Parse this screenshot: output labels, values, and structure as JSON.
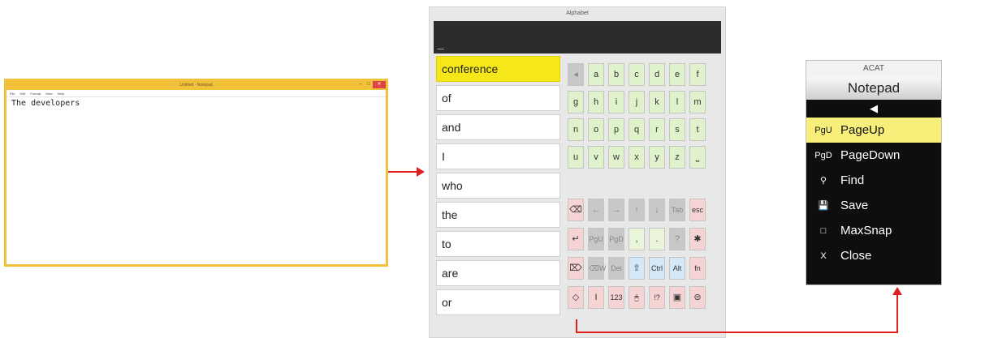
{
  "notepad": {
    "title": "Untitled - Notepad",
    "controls": [
      "–",
      "□",
      "✕"
    ],
    "menu": [
      "File",
      "Edit",
      "Format",
      "View",
      "Help"
    ],
    "text": "The developers"
  },
  "alphabet": {
    "title": "Alphabet",
    "input_cursor": "_",
    "words": [
      "conference",
      "of",
      "and",
      "I",
      "who",
      "the",
      "to",
      "are",
      "or"
    ],
    "letters": [
      [
        "◂",
        "a",
        "b",
        "c",
        "d",
        "e",
        "f"
      ],
      [
        "g",
        "h",
        "i",
        "j",
        "k",
        "l",
        "m"
      ],
      [
        "n",
        "o",
        "p",
        "q",
        "r",
        "s",
        "t"
      ],
      [
        "u",
        "v",
        "w",
        "x",
        "y",
        "z",
        "⎵"
      ]
    ],
    "controls": [
      [
        "⌫",
        "←",
        "→",
        "↑",
        "↓",
        "Tab",
        "esc"
      ],
      [
        "↵",
        "PgU",
        "PgD",
        ",",
        ".",
        "?",
        "✱"
      ],
      [
        "⌦",
        "⌫W",
        "Del",
        "⇧",
        "Ctrl",
        "Alt",
        "fn"
      ],
      [
        "◇",
        "I",
        "123",
        "🖱",
        "!?",
        "▣",
        "⊜"
      ]
    ]
  },
  "acat": {
    "title": "ACAT",
    "app": "Notepad",
    "back": "◀",
    "items": [
      {
        "icon": "PgU",
        "label": "PageUp"
      },
      {
        "icon": "PgD",
        "label": "PageDown"
      },
      {
        "icon": "⚲",
        "label": "Find"
      },
      {
        "icon": "💾",
        "label": "Save"
      },
      {
        "icon": "□",
        "label": "MaxSnap"
      },
      {
        "icon": "X",
        "label": "Close"
      }
    ]
  },
  "colors": {
    "arrow": "#e02020",
    "highlight_yellow": "#f6e71a",
    "acat_highlight": "#f8ef7a"
  }
}
